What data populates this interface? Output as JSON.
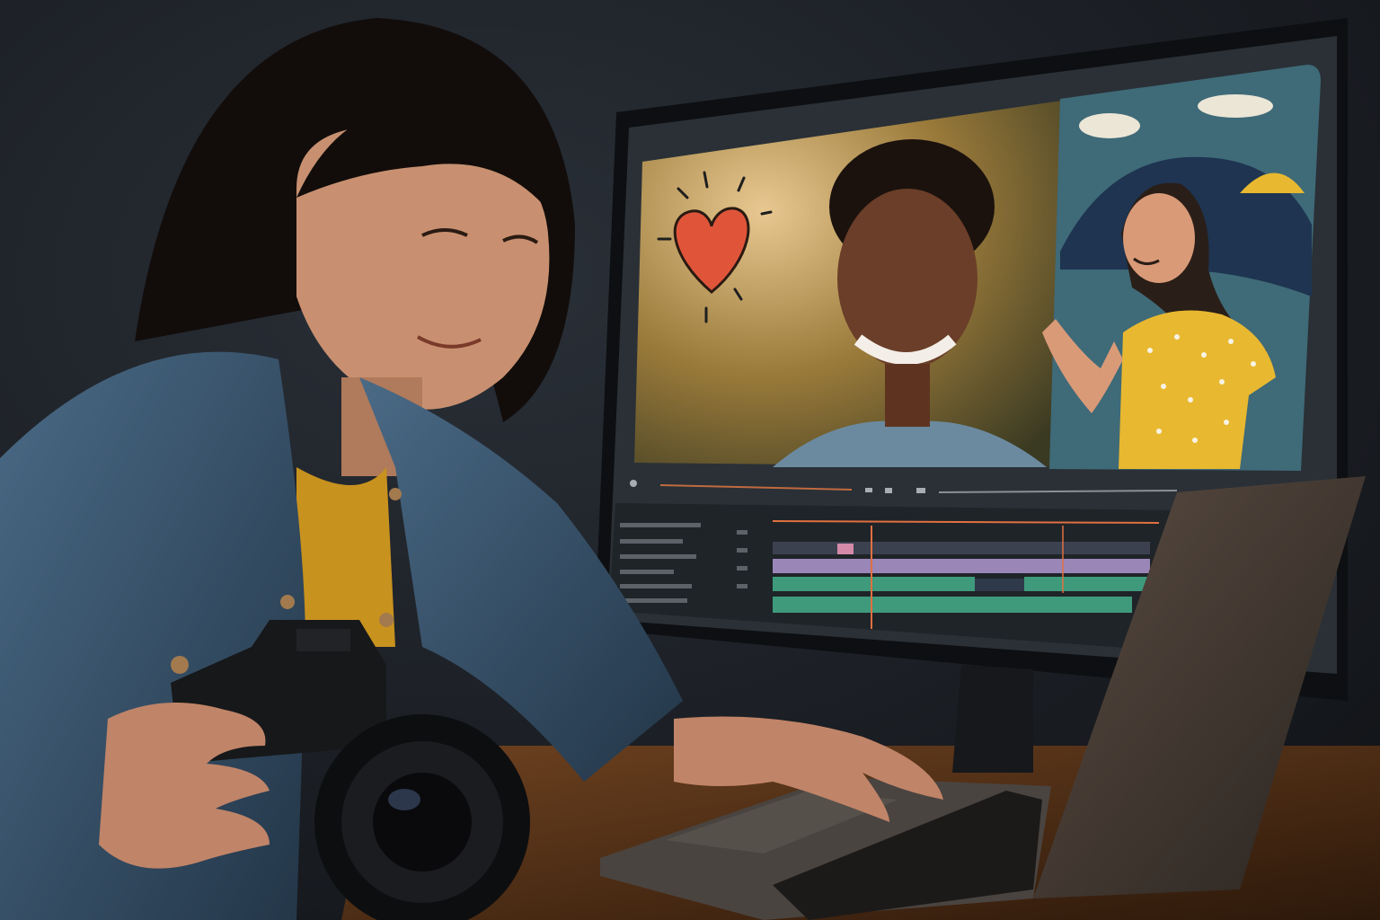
{
  "scene": {
    "description_tags": [
      "video-editor",
      "woman-with-camera",
      "laptop",
      "monitor"
    ],
    "colors": {
      "wall": "#1d2228",
      "desk": "#5a3418",
      "accent_playhead": "#e07040",
      "track_purple": "#9b86b8",
      "track_green": "#3f9a7c",
      "track_pink": "#d48aa8",
      "illustration_bg": "#3f6a78",
      "shirt_yellow": "#e8b830",
      "heart_red": "#e0553a"
    }
  },
  "monitor": {
    "preview": {
      "left_clip": "photo-smiling-person",
      "right_clip": "illustration-waving-woman"
    },
    "timeline": {
      "track_count": 4,
      "playhead_position": 0.27,
      "selection_end": 0.78
    }
  }
}
